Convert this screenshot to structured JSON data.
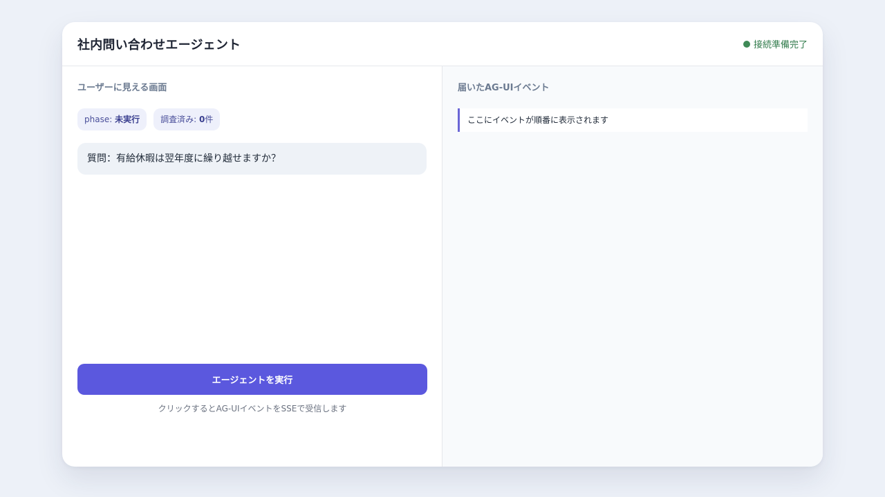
{
  "header": {
    "title": "社内問い合わせエージェント",
    "status_text": "接続準備完了",
    "status_color": "#3f8a57"
  },
  "left_panel": {
    "section_title": "ユーザーに見える画面",
    "chips": {
      "phase_label": "phase: ",
      "phase_value": "未実行",
      "investigated_label": "調査済み: ",
      "investigated_count": "0",
      "investigated_unit": "件"
    },
    "question": "質問：有給休暇は翌年度に繰り越せますか？",
    "run_button_label": "エージェントを実行",
    "hint": "クリックするとAG-UIイベントをSSEで受信します",
    "accent_color": "#5b58de"
  },
  "right_panel": {
    "section_title": "届いたAG-UIイベント",
    "events": [
      "ここにイベントが順番に表示されます"
    ]
  }
}
